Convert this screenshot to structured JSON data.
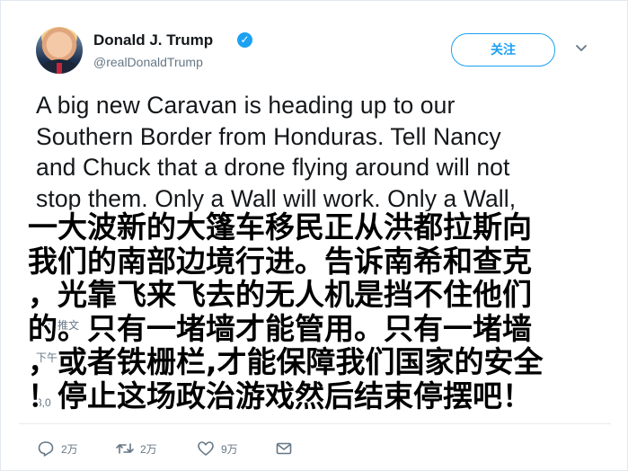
{
  "author": {
    "name": "Donald J. Trump",
    "handle": "@realDonaldTrump",
    "verified_mark": "✓"
  },
  "header": {
    "follow_label": "关注",
    "menu_icon": "chevron-down-icon"
  },
  "tweet": {
    "lines": [
      "A big new Caravan is heading up to our",
      "Southern Border from Honduras. Tell Nancy",
      "and Chuck that a drone flying around will not",
      "stop them. Only a Wall will work. Only a Wall,"
    ]
  },
  "partial": {
    "translate": "翻译推文",
    "time": "下午",
    "stats": "3,0"
  },
  "caption": {
    "lines": [
      "一大波新的大篷车移民正从洪都拉斯向",
      "我们的南部边境行进。告诉南希和查克",
      "，光靠飞来飞去的无人机是挡不住他们",
      "的。只有一堵墙才能管用。只有一堵墙",
      "，或者铁栅栏,才能保障我们国家的安全",
      "！停止这场政治游戏然后结束停摆吧！"
    ]
  },
  "actions": {
    "reply_count": "2万",
    "retweet_count": "2万",
    "like_count": "9万"
  },
  "colors": {
    "accent": "#1da1f2",
    "secondary_text": "#657786",
    "primary_text": "#14171a"
  }
}
